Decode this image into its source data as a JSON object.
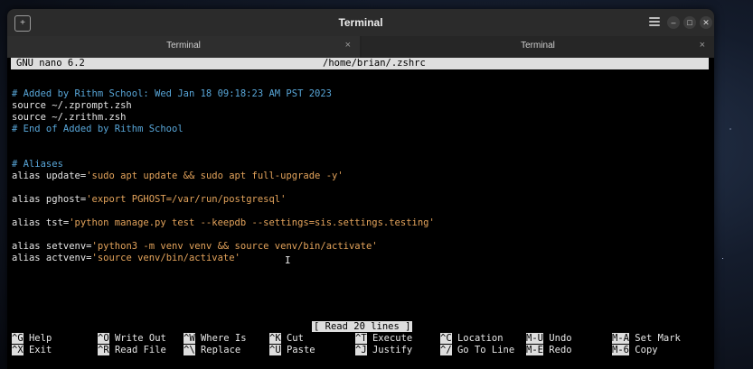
{
  "window": {
    "title": "Terminal"
  },
  "tabs": [
    {
      "label": "Terminal",
      "close": "×"
    },
    {
      "label": "Terminal",
      "close": "×"
    }
  ],
  "nano": {
    "version": "GNU nano 6.2",
    "filename": "/home/brian/.zshrc",
    "lines": [
      {
        "text": "# Added by Rithm School: Wed Jan 18 09:18:23 AM PST 2023",
        "type": "comment"
      },
      {
        "text": "source ~/.zprompt.zsh",
        "type": "plain"
      },
      {
        "text": "source ~/.zrithm.zsh",
        "type": "plain"
      },
      {
        "text": "# End of Added by Rithm School",
        "type": "comment"
      },
      {
        "text": "# Aliases",
        "type": "comment"
      },
      {
        "prefix": "alias update=",
        "str": "'sudo apt update && sudo apt full-upgrade -y'"
      },
      {
        "prefix": "alias pghost=",
        "str": "'export PGHOST=/var/run/postgresql'"
      },
      {
        "prefix": "alias tst=",
        "str": "'python manage.py test --keepdb --settings=sis.settings.testing'"
      },
      {
        "prefix": "alias setvenv=",
        "str": "'python3 -m venv venv && source venv/bin/activate'"
      },
      {
        "prefix": "alias actvenv=",
        "str": "'source venv/bin/activate'"
      }
    ],
    "status_message": "[ Read 20 lines ]",
    "shortcuts": [
      {
        "key": "^G",
        "label": "Help"
      },
      {
        "key": "^X",
        "label": "Exit"
      },
      {
        "key": "^O",
        "label": "Write Out"
      },
      {
        "key": "^R",
        "label": "Read File"
      },
      {
        "key": "^W",
        "label": "Where Is"
      },
      {
        "key": "^\\",
        "label": "Replace"
      },
      {
        "key": "^K",
        "label": "Cut"
      },
      {
        "key": "^U",
        "label": "Paste"
      },
      {
        "key": "^T",
        "label": "Execute"
      },
      {
        "key": "^J",
        "label": "Justify"
      },
      {
        "key": "^C",
        "label": "Location"
      },
      {
        "key": "^/",
        "label": "Go To Line"
      },
      {
        "key": "M-U",
        "label": "Undo"
      },
      {
        "key": "M-E",
        "label": "Redo"
      },
      {
        "key": "M-A",
        "label": "Set Mark"
      },
      {
        "key": "M-6",
        "label": "Copy"
      }
    ]
  },
  "colors": {
    "comment": "#58a6d8",
    "string": "#e3a35b",
    "bar": "#dedede"
  }
}
